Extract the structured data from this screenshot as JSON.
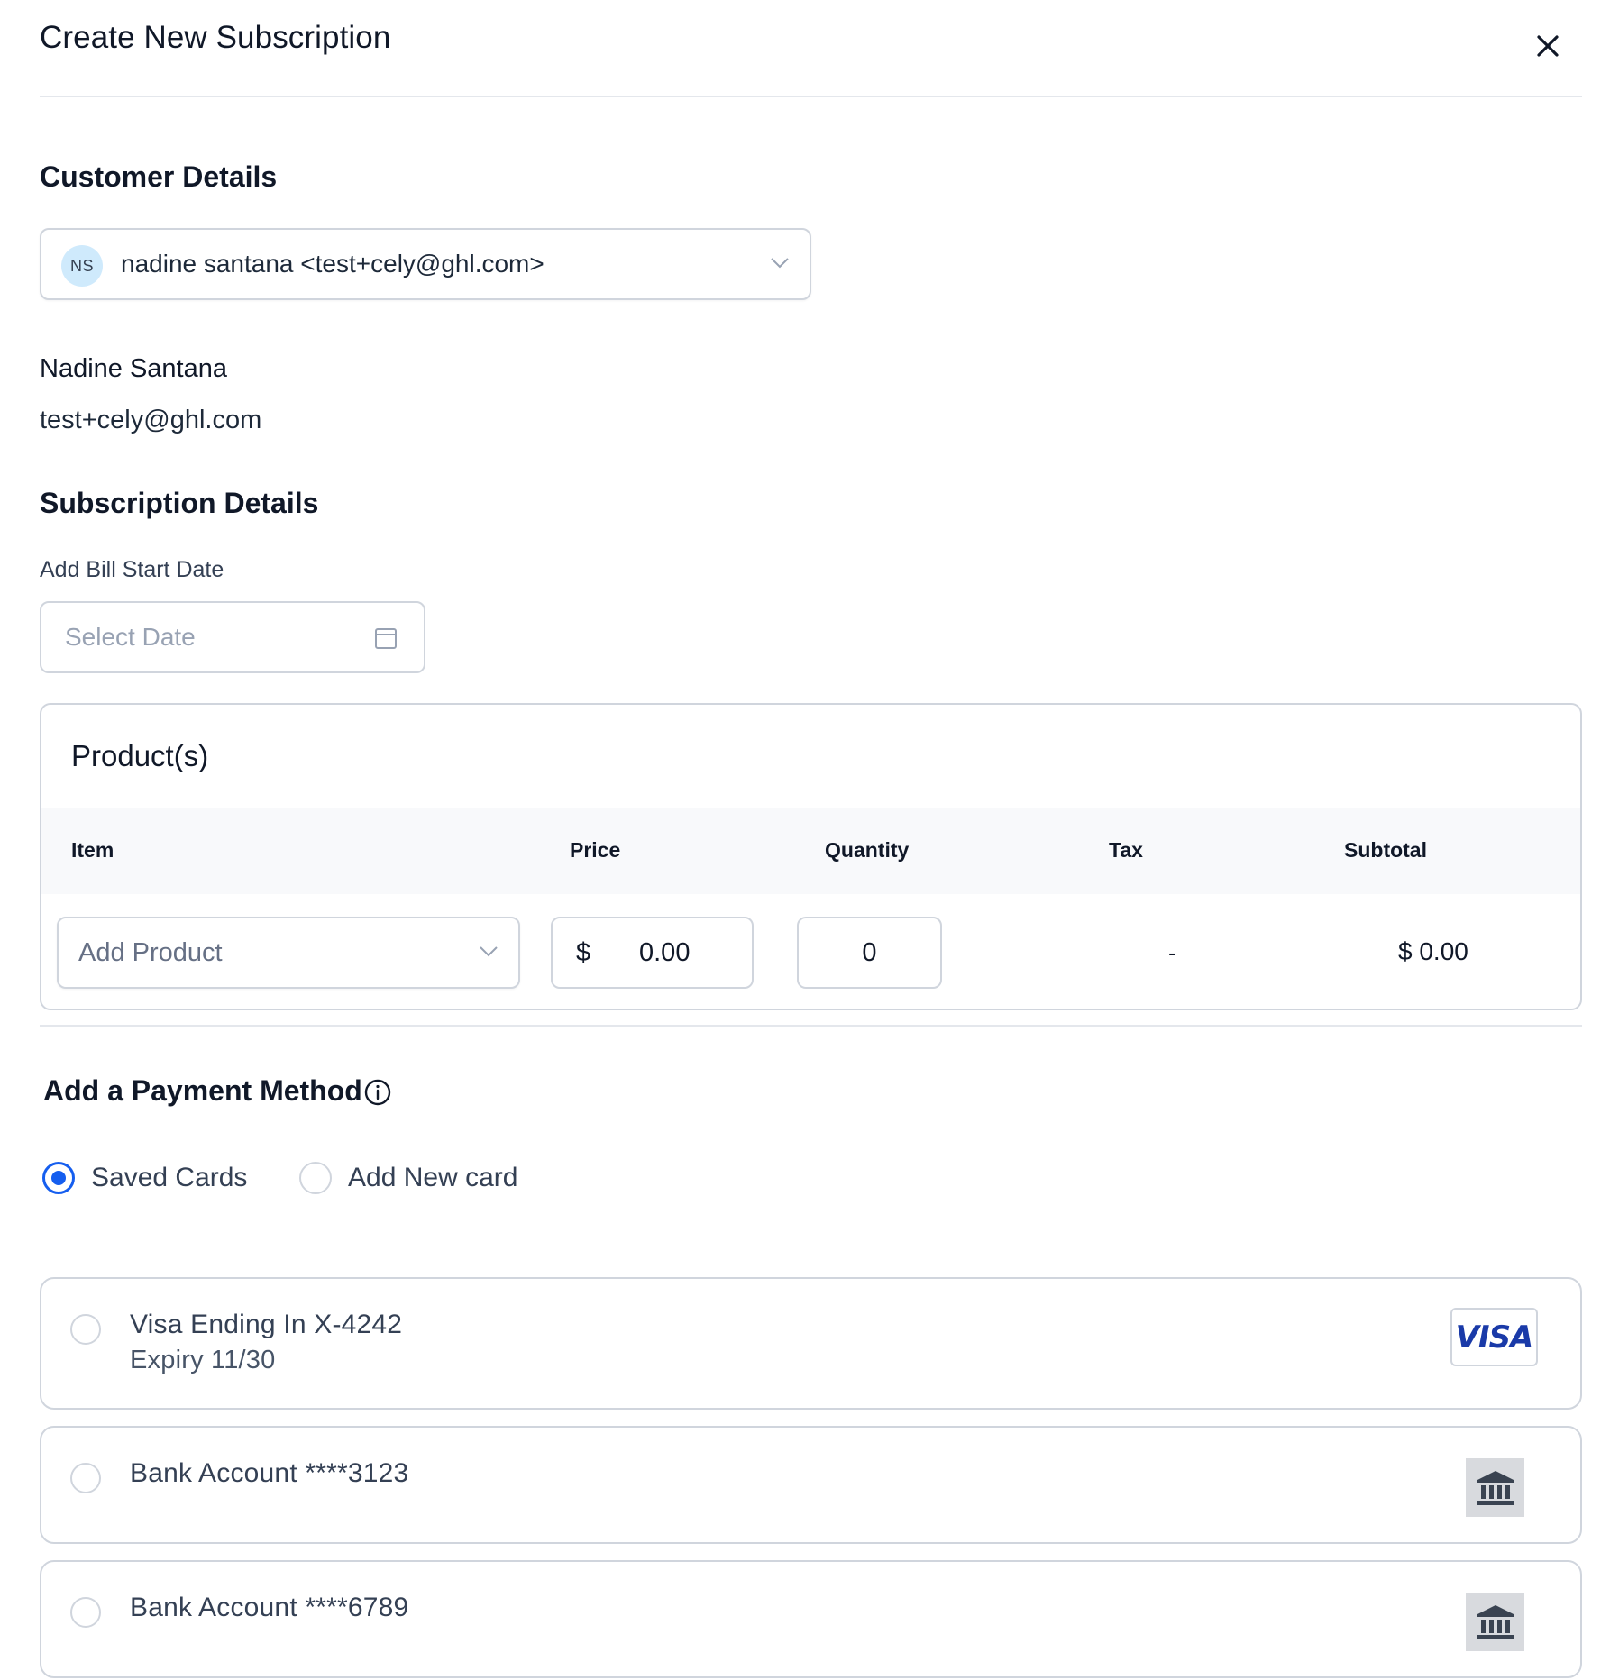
{
  "modal": {
    "title": "Create New Subscription"
  },
  "customer": {
    "section_title": "Customer Details",
    "select_initials": "NS",
    "select_value": "nadine santana <test+cely@ghl.com>",
    "name": "Nadine Santana",
    "email": "test+cely@ghl.com"
  },
  "subscription": {
    "section_title": "Subscription Details",
    "start_date_label": "Add Bill Start Date",
    "start_date_placeholder": "Select Date"
  },
  "products": {
    "title": "Product(s)",
    "columns": [
      "Item",
      "Price",
      "Quantity",
      "Tax",
      "Subtotal"
    ],
    "row": {
      "item_placeholder": "Add Product",
      "price_currency": "$",
      "price_value": "0.00",
      "quantity": "0",
      "tax": "-",
      "subtotal": "$ 0.00"
    }
  },
  "payment": {
    "section_title": "Add a Payment Method",
    "options": [
      {
        "label": "Saved Cards",
        "selected": true
      },
      {
        "label": "Add New card",
        "selected": false
      }
    ],
    "saved_methods": [
      {
        "line1": "Visa Ending In X-4242",
        "line2": "Expiry 11/30",
        "brand": "VISA",
        "icon": "visa-logo"
      },
      {
        "line1": "Bank Account ****3123",
        "icon": "bank-icon"
      },
      {
        "line1": "Bank Account ****6789",
        "icon": "bank-icon"
      }
    ]
  },
  "colors": {
    "accent": "#155eef",
    "border": "#d0d5dd",
    "avatar_bg": "#cfeafc",
    "visa_blue": "#1a3aa8"
  }
}
